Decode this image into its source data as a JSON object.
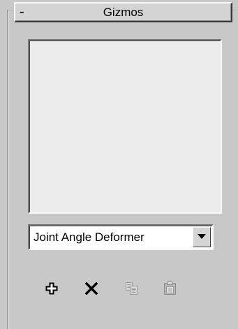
{
  "rollout": {
    "collapse_symbol": "-",
    "title": "Gizmos"
  },
  "gizmo_list": {
    "items": []
  },
  "gizmo_type": {
    "selected": "Joint Angle Deformer"
  },
  "toolbar": {
    "buttons": [
      {
        "name": "add-gizmo",
        "icon": "plus-icon",
        "enabled": true
      },
      {
        "name": "delete-gizmo",
        "icon": "delete-x-icon",
        "enabled": true
      },
      {
        "name": "copy-gizmo",
        "icon": "copy-icon",
        "enabled": false
      },
      {
        "name": "paste-gizmo",
        "icon": "paste-icon",
        "enabled": false
      }
    ]
  },
  "colors": {
    "panel": "#c8c8c8",
    "list_background": "#ececec",
    "disabled_icon": "#9a9a9a"
  }
}
